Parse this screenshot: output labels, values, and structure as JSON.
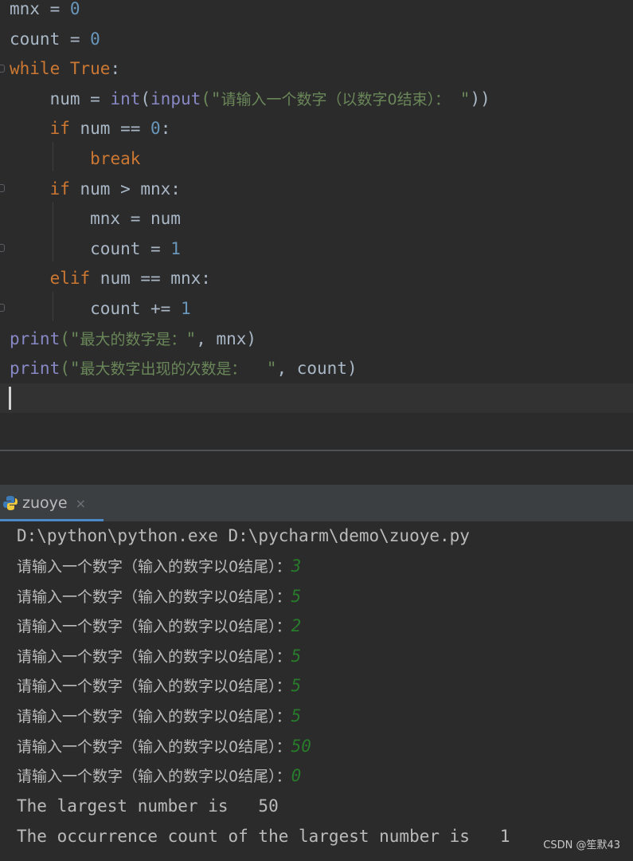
{
  "editor": {
    "lines": [
      {
        "tokens": [
          {
            "t": "mnx = ",
            "c": ""
          },
          {
            "t": "0",
            "c": "num"
          }
        ]
      },
      {
        "tokens": [
          {
            "t": "count = ",
            "c": ""
          },
          {
            "t": "0",
            "c": "num"
          }
        ]
      },
      {
        "tokens": [
          {
            "t": "while ",
            "c": "kw"
          },
          {
            "t": "True",
            "c": "kw"
          },
          {
            "t": ":",
            "c": ""
          }
        ]
      },
      {
        "tokens": [
          {
            "t": "    num = ",
            "c": ""
          },
          {
            "t": "int",
            "c": "fn"
          },
          {
            "t": "(",
            "c": ""
          },
          {
            "t": "input",
            "c": "fn"
          },
          {
            "t": "(\"",
            "c": "str"
          },
          {
            "t": "请输入一个数字（以数字0结束）：",
            "c": "str cjk"
          },
          {
            "t": " \"",
            "c": "str"
          },
          {
            "t": "))",
            "c": ""
          }
        ]
      },
      {
        "tokens": [
          {
            "t": "    ",
            "c": ""
          },
          {
            "t": "if ",
            "c": "kw"
          },
          {
            "t": "num == ",
            "c": ""
          },
          {
            "t": "0",
            "c": "num"
          },
          {
            "t": ":",
            "c": ""
          }
        ]
      },
      {
        "tokens": [
          {
            "t": "        ",
            "c": ""
          },
          {
            "t": "break",
            "c": "kw"
          }
        ]
      },
      {
        "tokens": [
          {
            "t": "    ",
            "c": ""
          },
          {
            "t": "if ",
            "c": "kw"
          },
          {
            "t": "num > mnx:",
            "c": ""
          }
        ]
      },
      {
        "tokens": [
          {
            "t": "        mnx = num",
            "c": ""
          }
        ]
      },
      {
        "tokens": [
          {
            "t": "        count = ",
            "c": ""
          },
          {
            "t": "1",
            "c": "num"
          }
        ]
      },
      {
        "tokens": [
          {
            "t": "    ",
            "c": ""
          },
          {
            "t": "elif ",
            "c": "kw"
          },
          {
            "t": "num == mnx:",
            "c": ""
          }
        ]
      },
      {
        "tokens": [
          {
            "t": "        count += ",
            "c": ""
          },
          {
            "t": "1",
            "c": "num"
          }
        ]
      },
      {
        "tokens": [
          {
            "t": "print",
            "c": "fn"
          },
          {
            "t": "(\"",
            "c": "str"
          },
          {
            "t": "最大的数字是：",
            "c": "str cjk"
          },
          {
            "t": "\"",
            "c": "str"
          },
          {
            "t": ", mnx)",
            "c": ""
          }
        ]
      },
      {
        "tokens": [
          {
            "t": "print",
            "c": "fn"
          },
          {
            "t": "(\"",
            "c": "str"
          },
          {
            "t": "最大数字出现的次数是：",
            "c": "str cjk"
          },
          {
            "t": "  \"",
            "c": "str"
          },
          {
            "t": ", count)",
            "c": ""
          }
        ]
      }
    ]
  },
  "run_tab": {
    "label": "zuoye",
    "close_glyph": "×",
    "icon": "python-icon"
  },
  "console": {
    "command": "D:\\python\\python.exe D:\\pycharm\\demo\\zuoye.py",
    "prompt": "请输入一个数字（输入的数字以0结尾）：",
    "inputs": [
      "3",
      "5",
      "2",
      "5",
      "5",
      "5",
      "50",
      "0"
    ],
    "result_lines": [
      "The largest number is   50",
      "The occurrence count of the largest number is   1"
    ]
  },
  "watermark": "CSDN @笙默43",
  "colors": {
    "keyword": "#cc7832",
    "builtin": "#8888c6",
    "number": "#6897bb",
    "string": "#6a8759",
    "user_input": "#287b2b",
    "editor_bg": "#2b2b2b"
  }
}
